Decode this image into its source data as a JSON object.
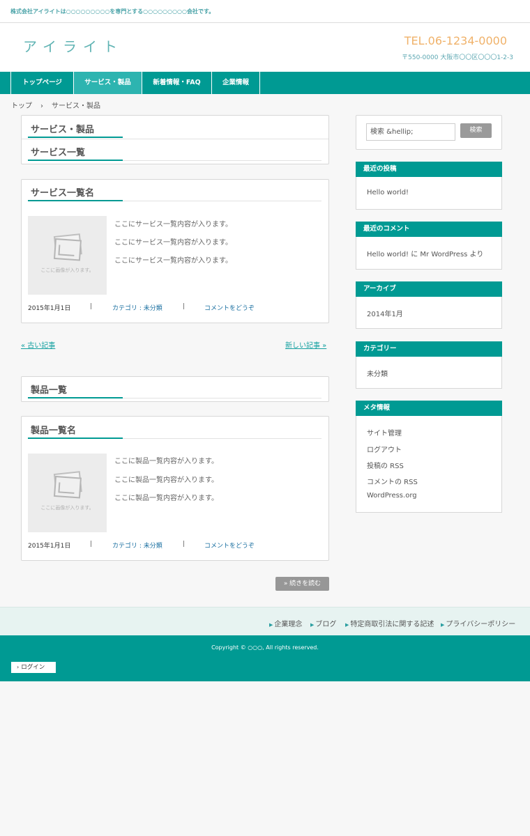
{
  "site": {
    "tagline": "株式会社アイライトは○○○○○○○○○を専門とする○○○○○○○○○会社です。",
    "logo": "アイライト",
    "tel": "TEL.06-1234-0000",
    "address": "〒550-0000 大阪市〇〇区〇〇〇1-2-3"
  },
  "nav": {
    "items": [
      {
        "label": "トップページ"
      },
      {
        "label": "サービス・製品"
      },
      {
        "label": "新着情報・FAQ"
      },
      {
        "label": "企業情報"
      }
    ]
  },
  "breadcrumb": {
    "home": "トップ",
    "separator": "›",
    "current": "サービス・製品"
  },
  "main": {
    "page_title": "サービス・製品",
    "services": {
      "section_title": "サービス一覧",
      "post": {
        "title": "サービス一覧名",
        "thumb_caption": "ここに画像が入ります。",
        "lines": [
          "ここにサービス一覧内容が入ります。",
          "ここにサービス一覧内容が入ります。",
          "ここにサービス一覧内容が入ります。"
        ],
        "date": "2015年1月1日",
        "category": "カテゴリ : 未分類",
        "comment": "コメントをどうぞ",
        "sep": "|"
      }
    },
    "pager": {
      "older": "« 古い記事",
      "newer": "新しい記事 »"
    },
    "products": {
      "section_title": "製品一覧",
      "post": {
        "title": "製品一覧名",
        "thumb_caption": "ここに画像が入ります。",
        "lines": [
          "ここに製品一覧内容が入ります。",
          "ここに製品一覧内容が入ります。",
          "ここに製品一覧内容が入ります。"
        ],
        "date": "2015年1月1日",
        "category": "カテゴリ : 未分類",
        "comment": "コメントをどうぞ",
        "sep": "|"
      }
    },
    "read_more": "» 続きを読む"
  },
  "sidebar": {
    "search": {
      "placeholder": "検索 &hellip;",
      "button": "検索"
    },
    "widgets": [
      {
        "title": "最近の投稿",
        "items": [
          "Hello world!"
        ]
      },
      {
        "title": "最近のコメント",
        "items": [
          "Hello world! に Mr WordPress より"
        ]
      },
      {
        "title": "アーカイブ",
        "items": [
          "2014年1月"
        ]
      },
      {
        "title": "カテゴリー",
        "items": [
          "未分類"
        ]
      },
      {
        "title": "メタ情報",
        "items": [
          "サイト管理",
          "ログアウト",
          "投稿の RSS",
          "コメントの RSS",
          "WordPress.org"
        ]
      }
    ]
  },
  "footer": {
    "links": [
      "企業理念",
      "ブログ",
      "特定商取引法に関する記述",
      "プライバシーポリシー"
    ],
    "copyright": "Copyright © ○○○, All rights reserved.",
    "login": "ログイン"
  },
  "colors": {
    "accent": "#009a93",
    "accent_light": "#2db4b0",
    "tel": "#f0b26a"
  }
}
